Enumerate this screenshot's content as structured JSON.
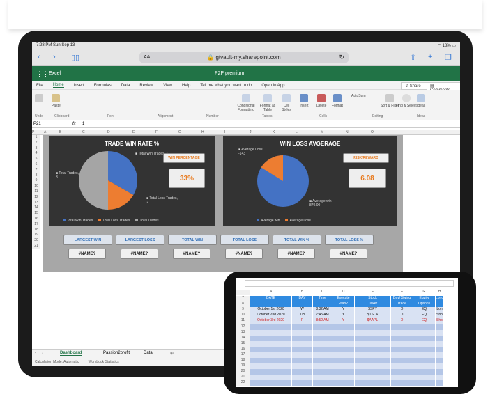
{
  "status": {
    "time": "7:28 PM",
    "date": "Sun Sep 13",
    "battery": "18%"
  },
  "browser": {
    "url": "gtvault-my.sharepoint.com",
    "aa": "AA"
  },
  "excel": {
    "app": "Excel",
    "doc": "P2P premium"
  },
  "menu": [
    "File",
    "Home",
    "Insert",
    "Formulas",
    "Data",
    "Review",
    "View",
    "Help",
    "Tell me what you want to do",
    "Open in App"
  ],
  "menu_right": {
    "share": "Share",
    "comments": "Comments"
  },
  "ribbon_groups": [
    "Undo",
    "Clipboard",
    "Font",
    "Alignment",
    "Number",
    "Tables",
    "Cells",
    "Editing",
    "Ideas"
  ],
  "ribbon_items": [
    "Paste",
    "Conditional Formatting",
    "Format as Table",
    "Cell Styles",
    "Insert",
    "Delete",
    "Format",
    "AutoSum",
    "Clear",
    "Sort & Filter",
    "Find & Select",
    "Ideas"
  ],
  "formula": {
    "cell": "P21",
    "value": "1"
  },
  "columns": [
    "A",
    "B",
    "C",
    "D",
    "E",
    "F",
    "G",
    "H",
    "I",
    "J",
    "K",
    "L",
    "M",
    "N",
    "O",
    "P"
  ],
  "rows": [
    "1",
    "2",
    "3",
    "4",
    "5",
    "6",
    "7",
    "8",
    "9",
    "10",
    "11",
    "12",
    "13",
    "14",
    "15",
    "16",
    "17",
    "18",
    "19",
    "20",
    "21"
  ],
  "chart1": {
    "title": "TRADE WIN RATE %",
    "label_win": "Total Win Trades, 1",
    "label_total": "Total Trades, 3",
    "label_loss": "Total Loss Trades, 2",
    "legend": [
      "Total Win Trades",
      "Total Loss Trades",
      "Total Trades"
    ]
  },
  "chart2": {
    "title": "WIN LOSS AVGERAGE",
    "label_loss": "Average Loss, -143",
    "label_win": "Average win, 870.00",
    "legend": [
      "Average win",
      "Average Loss"
    ]
  },
  "win_pct": {
    "label": "WIN PERCENTAGE",
    "value": "33%"
  },
  "risk": {
    "label": "RISK/REWARD",
    "value": "6.08"
  },
  "kpis": [
    {
      "label": "LARGEST WIN",
      "value": "#NAME?"
    },
    {
      "label": "LARGEST LOSS",
      "value": "#NAME?"
    },
    {
      "label": "TOTAL WIN",
      "value": "#NAME?"
    },
    {
      "label": "TOTAL LOSS",
      "value": "#NAME?"
    },
    {
      "label": "TOTAL WIN %",
      "value": "#NAME?"
    },
    {
      "label": "TOTAL LOSS %",
      "value": "#NAME?"
    }
  ],
  "sheets": [
    "Dashboard",
    "Passion2profit",
    "Data"
  ],
  "statusbar": [
    "Calculation Mode: Automatic",
    "Workbook Statistics"
  ],
  "phone": {
    "cols": [
      "A",
      "B",
      "C",
      "D",
      "E",
      "F",
      "G",
      "H"
    ],
    "header1": [
      "DATE",
      "DAY",
      "Time",
      "Execute",
      "Stock",
      "Day/ Swing",
      "Equity",
      "Long/S"
    ],
    "header2": [
      "",
      "",
      "",
      "Plan?",
      "Ticker",
      "Trade",
      "Options",
      ""
    ],
    "rows": [
      {
        "n": "9",
        "date": "October 1st 2020",
        "day": "W",
        "time": "8:32 AM",
        "plan": "Y",
        "ticker": "$SPY",
        "trade": "D",
        "opt": "EQ",
        "ls": "Lon"
      },
      {
        "n": "10",
        "date": "October 2nd 2020",
        "day": "TH",
        "time": "7:45 AM",
        "plan": "Y",
        "ticker": "$TSLA",
        "trade": "D",
        "opt": "EQ",
        "ls": "Sho"
      },
      {
        "n": "11",
        "date": "October 3rd 2020",
        "day": "F",
        "time": "8:52 AM",
        "plan": "Y",
        "ticker": "$AAPL",
        "trade": "D",
        "opt": "EQ",
        "ls": "Sho"
      }
    ],
    "empty_rows": [
      "12",
      "13",
      "14",
      "15",
      "16",
      "17",
      "18",
      "19",
      "20",
      "21",
      "22"
    ],
    "row_labels": [
      "7",
      "8"
    ]
  }
}
